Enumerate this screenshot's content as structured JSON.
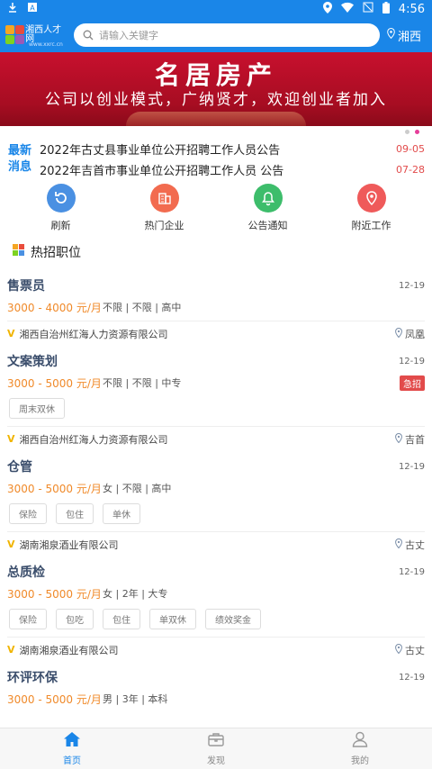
{
  "status_bar": {
    "time": "4:56"
  },
  "header": {
    "logo_text": "湘西人才网",
    "logo_sub": "www.xxrc.cn",
    "search_placeholder": "请输入关键字",
    "city": "湘西"
  },
  "banner": {
    "title": "名居房产",
    "slogan": "公司以创业模式，广纳贤才，欢迎创业者加入",
    "page_count": 2,
    "active_page": 2
  },
  "news": {
    "tag_line1": "最新",
    "tag_line2": "消息",
    "items": [
      {
        "title": "2022年古丈县事业单位公开招聘工作人员公告",
        "date": "09-05"
      },
      {
        "title": "2022年吉首市事业单位公开招聘工作人员 公告",
        "date": "07-28"
      }
    ]
  },
  "quick_links": [
    {
      "label": "刷新",
      "icon": "refresh-icon",
      "color": "#4a90e2"
    },
    {
      "label": "热门企业",
      "icon": "building-icon",
      "color": "#f26b4f"
    },
    {
      "label": "公告通知",
      "icon": "bell-icon",
      "color": "#3dbd6b"
    },
    {
      "label": "附近工作",
      "icon": "location-icon",
      "color": "#ef5a5a"
    }
  ],
  "section": {
    "title": "热招职位"
  },
  "jobs": [
    {
      "name": "售票员",
      "date": "12-19",
      "salary": "3000 - 4000 元/月",
      "req": "不限 | 不限 | 高中",
      "urgent": "",
      "tags": [],
      "company": "湘西自治州红海人力资源有限公司",
      "location": "凤凰"
    },
    {
      "name": "文案策划",
      "date": "12-19",
      "salary": "3000 - 5000 元/月",
      "req": "不限 | 不限 | 中专",
      "urgent": "急招",
      "tags": [
        "周末双休"
      ],
      "company": "湘西自治州红海人力资源有限公司",
      "location": "吉首"
    },
    {
      "name": "仓管",
      "date": "12-19",
      "salary": "3000 - 5000 元/月",
      "req": "女 | 不限 | 高中",
      "urgent": "",
      "tags": [
        "保险",
        "包住",
        "单休"
      ],
      "company": "湖南湘泉酒业有限公司",
      "location": "古丈"
    },
    {
      "name": "总质检",
      "date": "12-19",
      "salary": "3000 - 5000 元/月",
      "req": "女 | 2年 | 大专",
      "urgent": "",
      "tags": [
        "保险",
        "包吃",
        "包住",
        "单双休",
        "绩效奖金"
      ],
      "company": "湖南湘泉酒业有限公司",
      "location": "古丈"
    },
    {
      "name": "环评环保",
      "date": "12-19",
      "salary": "3000 - 5000 元/月",
      "req": "男 | 3年 | 本科",
      "urgent": "",
      "tags": [],
      "company": "",
      "location": ""
    }
  ],
  "tabbar": [
    {
      "label": "首页",
      "icon": "home-icon",
      "active": true
    },
    {
      "label": "发现",
      "icon": "briefcase-icon",
      "active": false
    },
    {
      "label": "我的",
      "icon": "user-icon",
      "active": false
    }
  ]
}
